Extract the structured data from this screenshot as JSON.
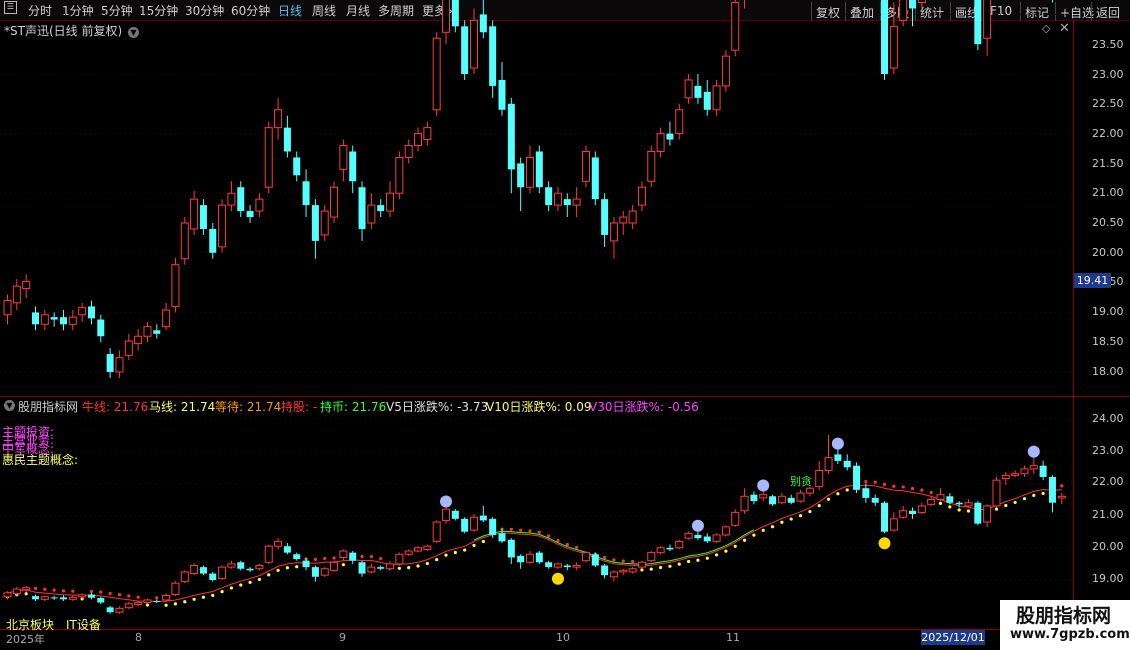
{
  "toolbar": {
    "periods": [
      "分时",
      "1分钟",
      "5分钟",
      "15分钟",
      "30分钟",
      "60分钟",
      "日线",
      "周线",
      "月线",
      "多周期",
      "更多"
    ],
    "active": "日线",
    "right_buttons": [
      "复权",
      "叠加",
      "多股",
      "统计",
      "画线",
      "F10",
      "标记",
      "+自选",
      "返回"
    ]
  },
  "main_title": "*ST声迅(日线 前复权)",
  "last_price_label": "19.41",
  "price_axis_labels": [
    "23.50",
    "23.00",
    "22.50",
    "22.00",
    "21.50",
    "21.00",
    "20.50",
    "20.00",
    "19.50",
    "19.00",
    "18.50",
    "18.00"
  ],
  "indicator": {
    "name": "股朋指标网",
    "niu": "牛线: 21.76",
    "ma": "马线: 21.74",
    "deng": "等待: 21.74",
    "chigu": "持股: -",
    "chibi": "持币: 21.76",
    "v5": "V5日涨跌%: -3.73",
    "v10": "V10日涨跌%: 0.09",
    "v30": "V30日涨跌%: -0.56",
    "colors": {
      "niu": "#ff3333",
      "ma": "#ffff66",
      "deng": "#ff9900",
      "chigu": "#ff3333",
      "chibi": "#33ff33",
      "v5": "#e0e0e0",
      "v10": "#ffff66",
      "v30": "#ff44ff"
    }
  },
  "themes": [
    {
      "text": "主题投资:",
      "color": "#ff44ff"
    },
    {
      "text": "主营业务:",
      "color": "#ff44ff"
    },
    {
      "text": "中军概念:",
      "color": "#ff44ff"
    },
    {
      "text": "惠民主题概念:",
      "color": "#ffff66"
    }
  ],
  "indicator_axis_labels": [
    "24.00",
    "23.00",
    "22.00",
    "21.00",
    "20.00",
    "19.00"
  ],
  "annotation_label": "别贪",
  "bottom": {
    "sector1": "北京板块",
    "sector2": "IT设备"
  },
  "dates": {
    "year": "2025年",
    "m8": "8",
    "m9": "9",
    "m10": "10",
    "m11": "11",
    "current": "2025/12/01"
  },
  "watermark": {
    "title": "股朋指标网",
    "url": "www.7gpzb.com"
  },
  "chart_data": {
    "type": "candlestick",
    "title": "*ST声迅(日线 前复权)",
    "ylim": [
      17.8,
      23.6
    ],
    "candles": [
      [
        18.48,
        18.6,
        18.4,
        18.65
      ],
      [
        18.58,
        18.72,
        18.52,
        18.78
      ],
      [
        18.7,
        18.76,
        18.62,
        18.82
      ],
      [
        18.5,
        18.4,
        18.35,
        18.55
      ],
      [
        18.4,
        18.48,
        18.35,
        18.52
      ],
      [
        18.46,
        18.44,
        18.38,
        18.5
      ],
      [
        18.46,
        18.4,
        18.35,
        18.52
      ],
      [
        18.4,
        18.46,
        18.35,
        18.52
      ],
      [
        18.48,
        18.54,
        18.42,
        18.58
      ],
      [
        18.55,
        18.45,
        18.4,
        18.6
      ],
      [
        18.44,
        18.3,
        18.25,
        18.48
      ],
      [
        18.15,
        18.0,
        17.95,
        18.2
      ],
      [
        18.0,
        18.12,
        17.95,
        18.18
      ],
      [
        18.14,
        18.26,
        18.1,
        18.32
      ],
      [
        18.24,
        18.3,
        18.18,
        18.36
      ],
      [
        18.3,
        18.38,
        18.25,
        18.42
      ],
      [
        18.35,
        18.32,
        18.28,
        18.4
      ],
      [
        18.38,
        18.52,
        18.35,
        18.58
      ],
      [
        18.55,
        18.9,
        18.5,
        18.96
      ],
      [
        18.95,
        19.25,
        18.9,
        19.3
      ],
      [
        19.2,
        19.45,
        19.15,
        19.52
      ],
      [
        19.4,
        19.2,
        19.15,
        19.45
      ],
      [
        19.2,
        19.0,
        18.95,
        19.25
      ],
      [
        19.05,
        19.4,
        19.0,
        19.45
      ],
      [
        19.4,
        19.5,
        19.35,
        19.6
      ],
      [
        19.55,
        19.35,
        19.3,
        19.6
      ],
      [
        19.35,
        19.3,
        19.25,
        19.4
      ],
      [
        19.35,
        19.45,
        19.3,
        19.5
      ],
      [
        19.55,
        20.05,
        19.5,
        20.1
      ],
      [
        20.05,
        20.2,
        19.95,
        20.3
      ],
      [
        20.05,
        19.85,
        19.8,
        20.15
      ],
      [
        19.8,
        19.65,
        19.6,
        19.85
      ],
      [
        19.6,
        19.4,
        19.3,
        19.7
      ],
      [
        19.4,
        19.1,
        18.95,
        19.45
      ],
      [
        19.15,
        19.35,
        19.1,
        19.4
      ],
      [
        19.3,
        19.55,
        19.25,
        19.6
      ],
      [
        19.7,
        19.9,
        19.6,
        19.95
      ],
      [
        19.85,
        19.6,
        19.5,
        19.9
      ],
      [
        19.55,
        19.2,
        19.1,
        19.6
      ],
      [
        19.25,
        19.4,
        19.2,
        19.5
      ],
      [
        19.4,
        19.35,
        19.3,
        19.45
      ],
      [
        19.35,
        19.5,
        19.3,
        19.6
      ],
      [
        19.5,
        19.8,
        19.45,
        19.85
      ],
      [
        19.8,
        19.9,
        19.75,
        19.95
      ],
      [
        19.9,
        20.0,
        19.85,
        20.05
      ],
      [
        19.95,
        20.05,
        19.9,
        20.1
      ],
      [
        20.2,
        20.8,
        20.15,
        20.85
      ],
      [
        20.85,
        21.2,
        20.75,
        21.25
      ],
      [
        21.15,
        20.9,
        20.85,
        21.2
      ],
      [
        20.9,
        20.5,
        20.45,
        20.95
      ],
      [
        20.55,
        20.95,
        20.5,
        21.05
      ],
      [
        21.0,
        20.85,
        20.8,
        21.3
      ],
      [
        20.9,
        20.4,
        20.3,
        20.95
      ],
      [
        20.45,
        20.2,
        20.15,
        20.6
      ],
      [
        20.25,
        19.7,
        19.5,
        20.3
      ],
      [
        19.75,
        19.55,
        19.35,
        19.8
      ],
      [
        19.55,
        19.8,
        19.5,
        19.9
      ],
      [
        19.85,
        19.55,
        19.5,
        19.9
      ],
      [
        19.55,
        19.4,
        19.35,
        19.6
      ],
      [
        19.4,
        19.5,
        19.35,
        19.55
      ],
      [
        19.45,
        19.4,
        19.3,
        19.5
      ],
      [
        19.4,
        19.45,
        19.3,
        19.55
      ],
      [
        19.6,
        19.85,
        19.55,
        19.9
      ],
      [
        19.8,
        19.45,
        19.4,
        19.85
      ],
      [
        19.45,
        19.15,
        19.05,
        19.5
      ],
      [
        19.1,
        19.25,
        18.95,
        19.3
      ],
      [
        19.25,
        19.3,
        19.15,
        19.35
      ],
      [
        19.25,
        19.35,
        19.2,
        19.4
      ],
      [
        19.4,
        19.55,
        19.35,
        19.6
      ],
      [
        19.6,
        19.85,
        19.55,
        19.9
      ],
      [
        19.85,
        20.0,
        19.8,
        20.05
      ],
      [
        20.0,
        19.95,
        19.9,
        20.1
      ],
      [
        20.0,
        20.2,
        19.95,
        20.25
      ],
      [
        20.3,
        20.45,
        20.25,
        20.5
      ],
      [
        20.4,
        20.3,
        20.25,
        20.5
      ],
      [
        20.35,
        20.2,
        20.15,
        20.45
      ],
      [
        20.2,
        20.4,
        20.15,
        20.45
      ],
      [
        20.4,
        20.65,
        20.35,
        20.7
      ],
      [
        20.7,
        21.1,
        20.65,
        21.2
      ],
      [
        21.15,
        21.6,
        21.05,
        21.85
      ],
      [
        21.65,
        21.45,
        21.35,
        21.75
      ],
      [
        21.55,
        21.65,
        21.45,
        21.75
      ],
      [
        21.6,
        21.35,
        21.3,
        21.65
      ],
      [
        21.4,
        21.6,
        21.35,
        21.7
      ],
      [
        21.55,
        21.4,
        21.35,
        21.65
      ],
      [
        21.45,
        21.7,
        21.4,
        21.8
      ],
      [
        21.7,
        21.85,
        21.6,
        21.9
      ],
      [
        21.9,
        22.4,
        21.8,
        22.7
      ],
      [
        22.4,
        22.8,
        22.3,
        23.5
      ],
      [
        22.9,
        22.7,
        22.6,
        23.05
      ],
      [
        22.7,
        22.5,
        22.4,
        22.9
      ],
      [
        22.55,
        21.8,
        21.7,
        22.65
      ],
      [
        21.85,
        21.55,
        21.4,
        22.0
      ],
      [
        21.55,
        21.4,
        21.3,
        21.65
      ],
      [
        21.4,
        20.5,
        20.45,
        21.45
      ],
      [
        20.55,
        20.9,
        20.5,
        21.1
      ],
      [
        20.95,
        21.15,
        20.9,
        21.3
      ],
      [
        21.15,
        21.05,
        20.9,
        21.25
      ],
      [
        21.1,
        21.3,
        21.05,
        21.4
      ],
      [
        21.35,
        21.5,
        21.3,
        21.6
      ],
      [
        21.5,
        21.65,
        21.45,
        21.85
      ],
      [
        21.6,
        21.4,
        21.35,
        21.7
      ],
      [
        21.4,
        21.35,
        21.25,
        21.45
      ],
      [
        21.3,
        21.4,
        21.25,
        21.5
      ],
      [
        21.4,
        20.75,
        20.7,
        21.45
      ],
      [
        20.8,
        21.3,
        20.65,
        21.35
      ],
      [
        21.3,
        22.1,
        21.25,
        22.2
      ],
      [
        22.15,
        22.25,
        21.95,
        22.35
      ],
      [
        22.25,
        22.3,
        22.2,
        22.4
      ],
      [
        22.3,
        22.45,
        22.2,
        22.55
      ],
      [
        22.45,
        22.55,
        22.3,
        22.8
      ],
      [
        22.55,
        22.2,
        22.1,
        22.7
      ],
      [
        22.2,
        21.4,
        21.1,
        22.25
      ],
      [
        21.55,
        21.6,
        21.35,
        21.7
      ]
    ],
    "theme_colors": {
      "up": "#ff3b3b",
      "down": "#54ffff",
      "niu": "#ff3333",
      "wait": "#ffff33",
      "band": "#33ff33"
    }
  }
}
